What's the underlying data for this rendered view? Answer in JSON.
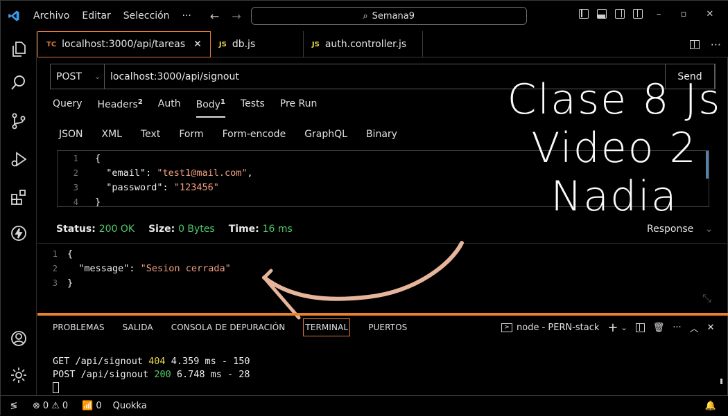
{
  "titlebar": {
    "menus": [
      "Archivo",
      "Editar",
      "Selección",
      "···"
    ],
    "search_text": "Semana9",
    "controls": [
      "–",
      "▫",
      "✕"
    ]
  },
  "tabs": [
    {
      "badge": "TC",
      "label": "localhost:3000/api/tareas",
      "close": "✕"
    },
    {
      "badge": "JS",
      "label": "db.js"
    },
    {
      "badge": "JS",
      "label": "auth.controller.js"
    }
  ],
  "request": {
    "method": "POST",
    "url": "localhost:3000/api/signout",
    "send": "Send"
  },
  "subtabs": [
    {
      "label": "Query",
      "count": ""
    },
    {
      "label": "Headers",
      "count": "2"
    },
    {
      "label": "Auth",
      "count": ""
    },
    {
      "label": "Body",
      "count": "1"
    },
    {
      "label": "Tests",
      "count": ""
    },
    {
      "label": "Pre Run",
      "count": ""
    }
  ],
  "body_tabs": [
    "JSON",
    "XML",
    "Text",
    "Form",
    "Form-encode",
    "GraphQL",
    "Binary"
  ],
  "body_lines": [
    {
      "n": "1",
      "text": "{"
    },
    {
      "n": "2",
      "key": "  \"email\"",
      "sep": ": ",
      "val": "\"test1@mail.com\"",
      "tail": ","
    },
    {
      "n": "3",
      "key": "  \"password\"",
      "sep": ": ",
      "val": "\"123456\"",
      "tail": ""
    },
    {
      "n": "4",
      "text": "}"
    }
  ],
  "status": {
    "status_label": "Status:",
    "status_value": "200 OK",
    "size_label": "Size:",
    "size_value": "0 Bytes",
    "time_label": "Time:",
    "time_value": "16 ms",
    "response_label": "Response"
  },
  "response_lines": [
    {
      "n": "1",
      "text": "{"
    },
    {
      "n": "2",
      "key": "  \"message\"",
      "sep": ": ",
      "val": "\"Sesion cerrada\""
    },
    {
      "n": "3",
      "text": "}"
    }
  ],
  "panel": {
    "tabs": [
      "PROBLEMAS",
      "SALIDA",
      "CONSOLA DE DEPURACIÓN",
      "TERMINAL",
      "PUERTOS"
    ],
    "terminal_name": "node - PERN-stack"
  },
  "terminal_lines": [
    {
      "a": "GET /api/signout ",
      "code": "404",
      "b": " 4.359 ms - 150",
      "color": "#e8d64a"
    },
    {
      "a": "POST /api/signout ",
      "code": "200",
      "b": " 6.748 ms - 28",
      "color": "#4ec96b"
    }
  ],
  "statusbar": {
    "errors": "0",
    "warnings": "0",
    "ports": "0",
    "extension": "Quokka"
  },
  "overlay": {
    "line1": "Clase 8 Js",
    "line2": "Video 2",
    "line3": "Nadia"
  },
  "colors": {
    "accent": "#e8812c",
    "ok": "#4ec96b",
    "warn": "#e8d64a",
    "string": "#f0a080"
  }
}
